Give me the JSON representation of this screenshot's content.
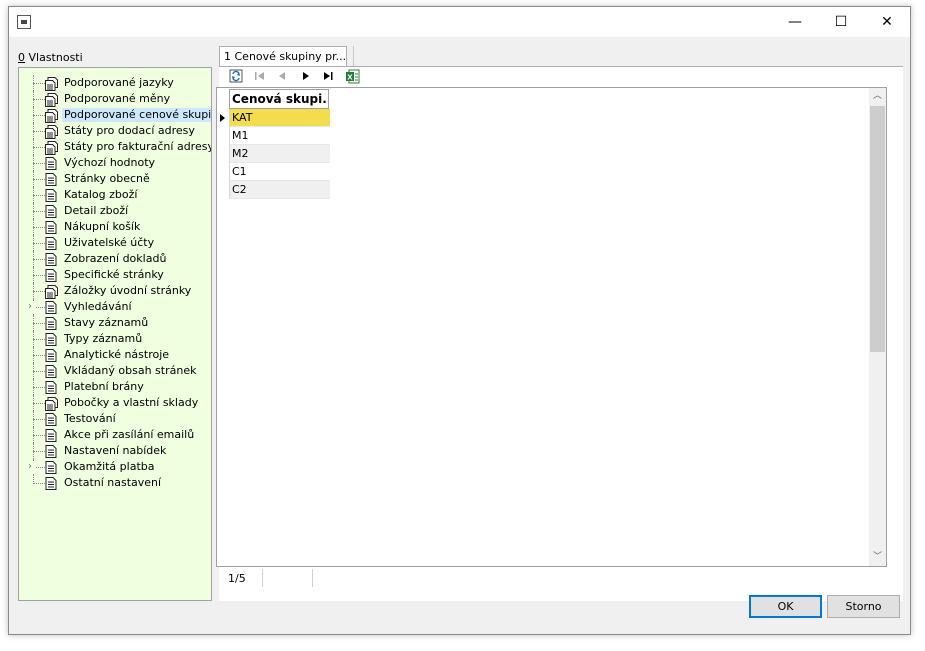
{
  "window": {
    "minimize_glyph": "—",
    "maximize_glyph": "☐",
    "close_glyph": "✕"
  },
  "left_panel": {
    "label_hotkey": "0",
    "label_rest": " Vlastnosti",
    "items": [
      {
        "label": "Podporované jazyky",
        "icon": "multi-page-icon"
      },
      {
        "label": "Podporované měny",
        "icon": "multi-page-icon"
      },
      {
        "label": "Podporované cenové skupiny",
        "icon": "multi-page-icon",
        "selected": true
      },
      {
        "label": "Státy pro dodací adresy",
        "icon": "multi-page-icon"
      },
      {
        "label": "Státy pro fakturační adresy",
        "icon": "multi-page-icon"
      },
      {
        "label": "Výchozí hodnoty",
        "icon": "page-icon"
      },
      {
        "label": "Stránky obecně",
        "icon": "page-icon"
      },
      {
        "label": "Katalog zboží",
        "icon": "page-icon"
      },
      {
        "label": "Detail zboží",
        "icon": "page-icon"
      },
      {
        "label": "Nákupní košík",
        "icon": "page-icon"
      },
      {
        "label": "Uživatelské účty",
        "icon": "page-icon"
      },
      {
        "label": "Zobrazení dokladů",
        "icon": "page-icon"
      },
      {
        "label": "Specifické stránky",
        "icon": "page-icon"
      },
      {
        "label": "Záložky úvodní stránky",
        "icon": "multi-page-icon"
      },
      {
        "label": "Vyhledávání",
        "icon": "page-icon",
        "expandable": true
      },
      {
        "label": "Stavy záznamů",
        "icon": "page-icon"
      },
      {
        "label": "Typy záznamů",
        "icon": "page-icon"
      },
      {
        "label": "Analytické nástroje",
        "icon": "page-icon"
      },
      {
        "label": "Vkládaný obsah stránek",
        "icon": "page-icon"
      },
      {
        "label": "Platební brány",
        "icon": "page-icon"
      },
      {
        "label": "Pobočky a vlastní sklady",
        "icon": "multi-page-icon"
      },
      {
        "label": "Testování",
        "icon": "page-icon"
      },
      {
        "label": "Akce při zasílání emailů",
        "icon": "page-icon"
      },
      {
        "label": "Nastavení nabídek",
        "icon": "page-icon"
      },
      {
        "label": "Okamžitá platba",
        "icon": "page-icon",
        "expandable": true
      },
      {
        "label": "Ostatní nastavení",
        "icon": "page-icon"
      }
    ]
  },
  "tab": {
    "label": "1 Cenové skupiny pr..."
  },
  "toolbar": {
    "refresh_icon": "refresh-icon",
    "first_icon": "first-record-icon",
    "prev_icon": "previous-record-icon",
    "next_icon": "next-record-icon",
    "last_icon": "last-record-icon",
    "excel_icon": "excel-export-icon"
  },
  "grid": {
    "column_header": "Cenová skupi...",
    "rows": [
      "KAT",
      "M1",
      "M2",
      "C1",
      "C2"
    ],
    "current_row": 0
  },
  "status": {
    "record_count": "1/5"
  },
  "buttons": {
    "ok": "OK",
    "cancel": "Storno"
  },
  "colors": {
    "tree_background": "#f0ffe0",
    "current_row": "#f3dd4f",
    "selection": "#cce8ff",
    "default_button_border": "#0078d7"
  }
}
